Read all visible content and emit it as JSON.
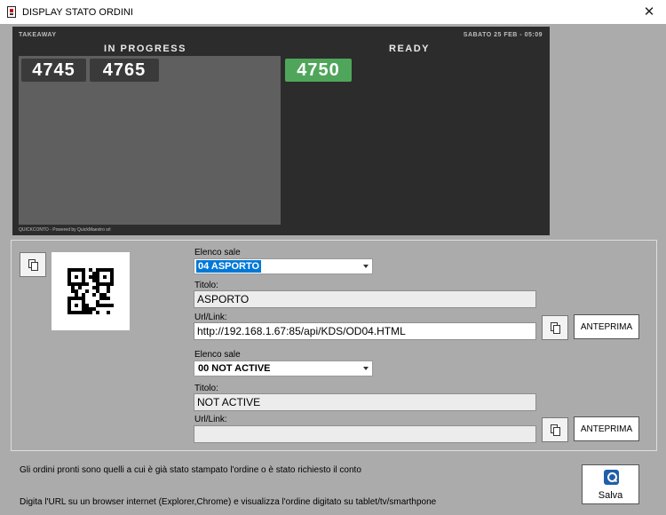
{
  "window": {
    "title": "DISPLAY STATO ORDINI",
    "icon": "document-app-icon",
    "close_label": "✕"
  },
  "preview": {
    "mode_label": "TAKEAWAY",
    "datetime": "SABATO 25 FEB - 05:09",
    "in_progress_heading": "IN PROGRESS",
    "ready_heading": "READY",
    "in_progress_orders": [
      "4745",
      "4765"
    ],
    "ready_orders": [
      "4750"
    ],
    "footer": "QUICKCONTO - Powered by QuickMaestro srl",
    "colors": {
      "background": "#2c2c2c",
      "panel": "#5f5f5f",
      "ready_ticket": "#4fa65a",
      "progress_ticket": "#3a3a3a"
    }
  },
  "config": {
    "qr_icon": "qr-code",
    "copy_icon": "copy-icon",
    "display1": {
      "rooms_label": "Elenco sale",
      "room_selected": "04 ASPORTO",
      "title_label": "Titolo:",
      "title_value": "ASPORTO",
      "url_label": "Url/Link:",
      "url_value": "http://192.168.1.67:85/api/KDS/OD04.HTML",
      "preview_button": "ANTEPRIMA"
    },
    "display2": {
      "rooms_label": "Elenco sale",
      "room_selected": "00 NOT ACTIVE",
      "title_label": "Titolo:",
      "title_value": "NOT ACTIVE",
      "url_label": "Url/Link:",
      "url_value": "",
      "preview_button": "ANTEPRIMA"
    }
  },
  "footer": {
    "info_line1": "Gli ordini pronti sono quelli a cui è già stato stampato l'ordine o è stato richiesto il conto",
    "info_line2": "Digita l'URL su un browser internet (Explorer,Chrome) e visualizza l'ordine digitato su tablet/tv/smarthpone",
    "save_button": "Salva",
    "save_icon": "search-globe-icon"
  }
}
